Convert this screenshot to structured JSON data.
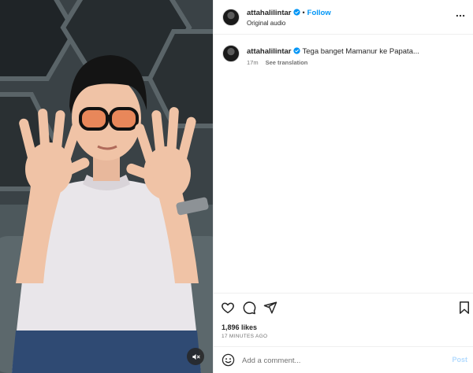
{
  "post": {
    "username": "attahalilintar",
    "follow_label": "Follow",
    "separator": "•",
    "audio": "Original audio"
  },
  "caption": {
    "username": "attahalilintar",
    "text": "Tega banget Mamanur ke Papata...",
    "time": "17m",
    "see_translation": "See translation"
  },
  "engagement": {
    "likes": "1,896 likes",
    "time_ago": "17 MINUTES AGO"
  },
  "comment_box": {
    "placeholder": "Add a comment...",
    "post_label": "Post"
  },
  "colors": {
    "accent": "#0095f6",
    "verified": "#0095f6",
    "post_disabled": "#b3dbff",
    "muted_text": "#737373"
  },
  "icons": [
    "verified-badge-icon",
    "more-options-icon",
    "heart-icon",
    "comment-icon",
    "share-icon",
    "bookmark-icon",
    "emoji-icon",
    "mute-icon"
  ]
}
